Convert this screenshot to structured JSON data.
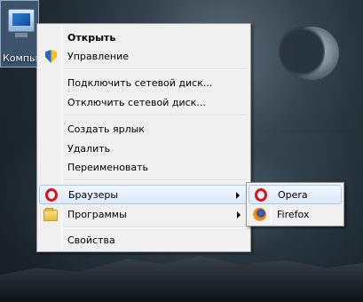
{
  "desktop": {
    "icon_label": "Компьютер"
  },
  "context_menu": {
    "items": [
      {
        "label": "Открыть",
        "bold": true
      },
      {
        "label": "Управление",
        "icon": "uac-shield-icon"
      },
      {
        "label": "Подключить сетевой диск..."
      },
      {
        "label": "Отключить сетевой диск..."
      },
      {
        "label": "Создать ярлык"
      },
      {
        "label": "Удалить"
      },
      {
        "label": "Переименовать"
      },
      {
        "label": "Браузеры",
        "icon": "opera-icon",
        "has_submenu": true,
        "highlighted": true
      },
      {
        "label": "Программы",
        "icon": "folder-icon",
        "has_submenu": true
      },
      {
        "label": "Свойства"
      }
    ]
  },
  "submenu": {
    "items": [
      {
        "label": "Opera",
        "icon": "opera-icon",
        "highlighted": true
      },
      {
        "label": "Firefox",
        "icon": "firefox-icon"
      }
    ]
  },
  "colors": {
    "menu_bg": "#f0f0f0",
    "highlight_bg": "#dde9f9",
    "highlight_border": "#a8c8ec",
    "opera_red": "#d7141a"
  }
}
